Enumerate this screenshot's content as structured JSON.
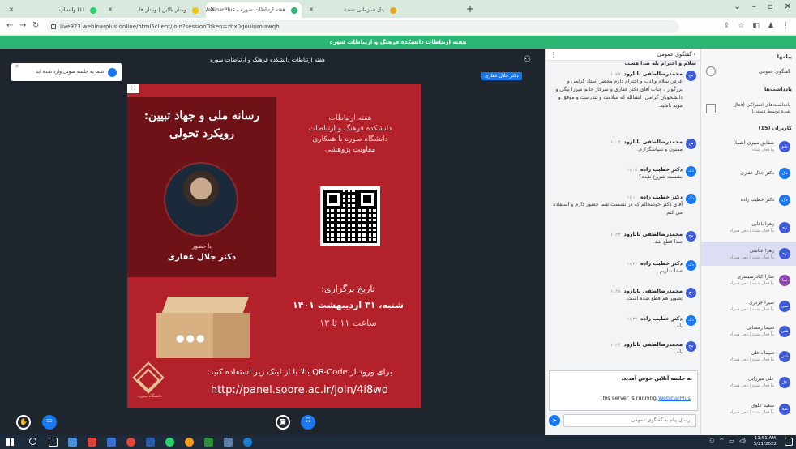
{
  "browser": {
    "tabs": [
      {
        "title": "(۱) واتساپ",
        "active": false,
        "color": "#25d366"
      },
      {
        "title": "وبینار بالاین | وبینار ها",
        "active": false,
        "color": "#f2c300"
      },
      {
        "title": "هفته ارتباطات سوره - WebinarPlus",
        "active": true,
        "color": "#2bb673"
      },
      {
        "title": "پنل سازمانی تست",
        "active": false,
        "color": "#e8a41b"
      }
    ],
    "url": "live923.webinarplus.online/html5client/join?sessionToken=zbx0gouirimiawqh"
  },
  "banner": {
    "text": "هفته ارتباطات دانشکده فرهنگ و ارتباطات سوره"
  },
  "stage": {
    "title": "هفته ارتباطات دانشکده فرهنگ و ارتباطات سوره",
    "toast": "شما به جلسه صوتی وارد شده اید",
    "presenter_badge": "دکتر جلال غفاری"
  },
  "slide": {
    "main_title_line1": "رسانه ملی و جهاد تبیین:",
    "main_title_line2": "رویکرد تحولی",
    "with_label": "با حضور",
    "guest": "دکتر جلال غفاری",
    "week_lines": [
      "هفته ارتباطات",
      "دانشکده فرهنگ و ارتباطات",
      "دانشگاه سوره با همکاری",
      "معاونت پژوهشی"
    ],
    "date_label": "تاریخ برگزاری:",
    "date_value": "شنبه، ۳۱ اردیبهشت ۱۴۰۱",
    "time_value": "ساعت ۱۱ تا ۱۳",
    "logo_caption": "دانشگاه سوره",
    "entry_text": "برای ورود از QR-Code بالا یا از لینک زیر استفاده کنید:",
    "entry_url": "http://panel.soore.ac.ir/join/4i8wd"
  },
  "chat": {
    "header": "گفتگوی عمومی",
    "top_partial": "سلام و احترام بله صدا هست",
    "messages": [
      {
        "initials": "مح",
        "color": "#3e5bd6",
        "sender": "محمدرضالطفی بابارود",
        "time": "۱۰:۵۷",
        "text": "عرض سلام و ادب و احترام دارم محضر استاد گرامی و بزرگوار ، جناب آقای دکتر غفاری و سرکار خانم میرزا بیگی و دانشجویان گرامی. انشالله که سلامت و تندرست و موفق و موید باشید."
      },
      {
        "initials": "مح",
        "color": "#3e5bd6",
        "sender": "محمدرضالطفی بابارود",
        "time": "۱۱:۰۲",
        "text": "ممنون و سپاسگزارم."
      },
      {
        "initials": "دک",
        "color": "#1877f2",
        "sender": "دکتر خطیب زاده",
        "time": "۱۱:۰۵",
        "text": "نشست شروع شده؟"
      },
      {
        "initials": "دک",
        "color": "#1877f2",
        "sender": "دکتر خطیب زاده",
        "time": "۱۱:۱۰",
        "text": "آقای دکتر خوشحالم که در نشست شما حضور دارم و استفاده می کنم"
      },
      {
        "initials": "مح",
        "color": "#3e5bd6",
        "sender": "محمدرضالطفی بابارود",
        "time": "۱۱:۲۴",
        "text": "صدا قطع شد."
      },
      {
        "initials": "دک",
        "color": "#1877f2",
        "sender": "دکتر خطیب زاده",
        "time": "۱۱:۲۶",
        "text": "صدا نداریم"
      },
      {
        "initials": "مح",
        "color": "#3e5bd6",
        "sender": "محمدرضالطفی بابارود",
        "time": "۱۱:۲۸",
        "text": "تصویر هم قطع شده است."
      },
      {
        "initials": "دک",
        "color": "#1877f2",
        "sender": "دکتر خطیب زاده",
        "time": "۱۱:۳۳",
        "text": "بله"
      },
      {
        "initials": "مح",
        "color": "#3e5bd6",
        "sender": "محمدرضالطفی بابارود",
        "time": "۱۱:۳۴",
        "text": "بله"
      }
    ],
    "welcome_line1": "به جلسه آنلاین خوش آمدید.",
    "welcome_line2_prefix": "This server is running ",
    "welcome_line2_link": "WebinarPlus",
    "welcome_line2_suffix": ".",
    "input_placeholder": "ارسال پیام به گفتگوی عمومی"
  },
  "sidebar": {
    "messages_section": "پیامها",
    "public_chat": "گفتگوی عمومی",
    "notes_section": "یادداشت‌ها",
    "shared_notes": "یادداشت‌های اشتراکی (فعال شده توسط دستی)",
    "users_section": "کاربران (15)",
    "users": [
      {
        "initials": "شو",
        "color": "#3e5bd6",
        "name": "شقایق سبزی (شما)",
        "status": "ماً فعال شده",
        "highlight": false
      },
      {
        "initials": "دک",
        "color": "#1877f2",
        "name": "دکتر جلال غفاری",
        "status": "",
        "highlight": false
      },
      {
        "initials": "دک",
        "color": "#1877f2",
        "name": "دکتر خطیب زاده",
        "status": "",
        "highlight": false
      },
      {
        "initials": "زه",
        "color": "#3e5bd6",
        "name": "زهرا باقایی",
        "status": "ماً فعال شده | تلفن همراه",
        "highlight": false
      },
      {
        "initials": "زه",
        "color": "#3e5bd6",
        "name": "زهرا عباسی",
        "status": "ماً فعال شده | تلفن همراه",
        "highlight": true
      },
      {
        "initials": "سا",
        "color": "#8e44ad",
        "name": "سارا کیادرسیسری",
        "status": "ماً فعال شده | تلفن همراه",
        "highlight": false
      },
      {
        "initials": "سی",
        "color": "#3e5bd6",
        "name": "سیرا جزدری",
        "status": "ماً فعال شده | تلفن همراه",
        "highlight": false
      },
      {
        "initials": "شی",
        "color": "#3e5bd6",
        "name": "شیما رمضانی",
        "status": "ماً فعال شده | تلفن همراه",
        "highlight": false
      },
      {
        "initials": "شی",
        "color": "#3e5bd6",
        "name": "شیما داغلی",
        "status": "ماً فعال شده | تلفن همراه",
        "highlight": false
      },
      {
        "initials": "عل",
        "color": "#3e5bd6",
        "name": "علی میرزایی",
        "status": "ماً فعال شده | تلفن همراه",
        "highlight": false
      },
      {
        "initials": "سه",
        "color": "#3e5bd6",
        "name": "سعید علوی",
        "status": "ماً فعال شده | تلفن همراه",
        "highlight": false
      }
    ]
  },
  "taskbar": {
    "time": "11:51 AM",
    "date": "5/21/2022"
  }
}
